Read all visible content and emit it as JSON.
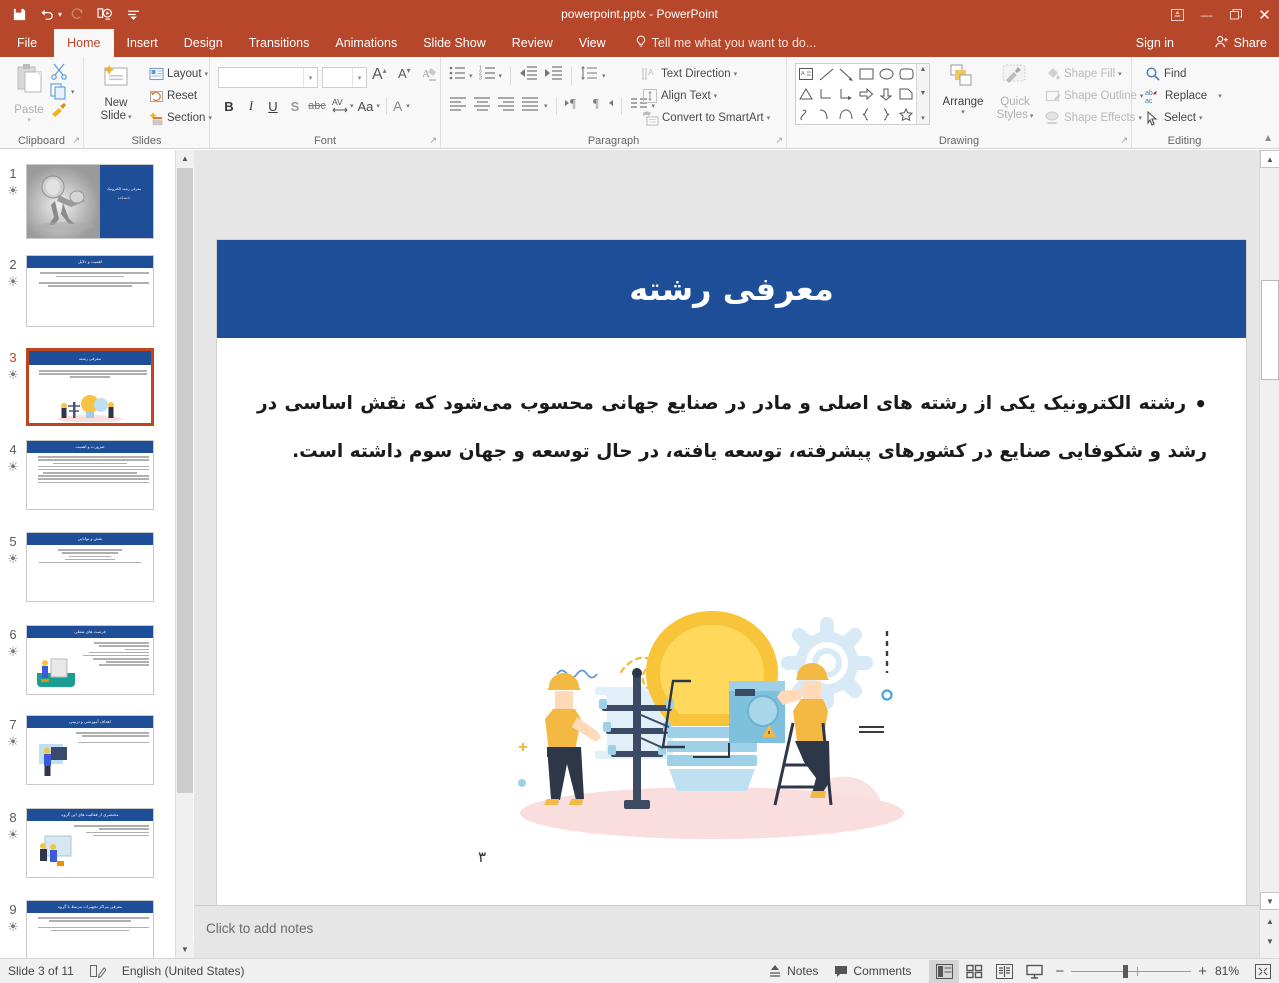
{
  "titlebar": {
    "document_title": "powerpoint.pptx - PowerPoint",
    "qat": [
      {
        "name": "save-icon",
        "label": "Save"
      },
      {
        "name": "undo-icon",
        "label": "Undo"
      },
      {
        "name": "redo-icon",
        "label": "Redo"
      },
      {
        "name": "start-presentation-icon",
        "label": "Start From Beginning"
      },
      {
        "name": "customize-qat-icon",
        "label": "Customize Quick Access Toolbar"
      }
    ],
    "window_controls": {
      "ribbon_display": "⬜",
      "minimize": "—",
      "restore": "❐",
      "close": "✕"
    }
  },
  "tabs": [
    {
      "label": "File",
      "active": false
    },
    {
      "label": "Home",
      "active": true
    },
    {
      "label": "Insert",
      "active": false
    },
    {
      "label": "Design",
      "active": false
    },
    {
      "label": "Transitions",
      "active": false
    },
    {
      "label": "Animations",
      "active": false
    },
    {
      "label": "Slide Show",
      "active": false
    },
    {
      "label": "Review",
      "active": false
    },
    {
      "label": "View",
      "active": false
    }
  ],
  "tellme": {
    "placeholder": "Tell me what you want to do..."
  },
  "account": {
    "signin": "Sign in",
    "share": "Share"
  },
  "ribbon": {
    "groups": [
      {
        "name": "clipboard",
        "label": "Clipboard"
      },
      {
        "name": "slides",
        "label": "Slides"
      },
      {
        "name": "font",
        "label": "Font"
      },
      {
        "name": "paragraph",
        "label": "Paragraph"
      },
      {
        "name": "drawing",
        "label": "Drawing"
      },
      {
        "name": "editing",
        "label": "Editing"
      }
    ],
    "clipboard": {
      "paste": "Paste",
      "cut": "Cut",
      "copy": "Copy",
      "format_painter": "Format Painter"
    },
    "slides": {
      "new_slide": "New\nSlide",
      "new_slide_line1": "New",
      "new_slide_line2": "Slide",
      "layout": "Layout",
      "reset": "Reset",
      "section": "Section"
    },
    "font": {
      "font_name": "",
      "font_size": "",
      "grow_font": "A",
      "shrink_font": "A",
      "clear_formatting": "Clear All Formatting",
      "bold": "B",
      "italic": "I",
      "underline": "U",
      "shadow": "S",
      "strikethrough": "abc",
      "character_spacing": "AV",
      "change_case": "Aa",
      "font_color": "A"
    },
    "paragraph": {
      "text_direction": "Text Direction",
      "align_text": "Align Text",
      "convert_to_smartart": "Convert to SmartArt"
    },
    "drawing": {
      "arrange": "Arrange",
      "quick_styles_line1": "Quick",
      "quick_styles_line2": "Styles",
      "shape_fill": "Shape Fill",
      "shape_outline": "Shape Outline",
      "shape_effects": "Shape Effects"
    },
    "editing": {
      "find": "Find",
      "replace": "Replace",
      "select": "Select"
    }
  },
  "slide_panel": {
    "slides": [
      {
        "number": "1",
        "title": "",
        "type": "picture-title",
        "selected": false
      },
      {
        "number": "2",
        "title": "اهمیت و دلایل",
        "type": "bullets",
        "selected": false
      },
      {
        "number": "3",
        "title": "معرفی رشته",
        "type": "bullets-image",
        "selected": true
      },
      {
        "number": "4",
        "title": "ضرورت و اهمیت",
        "type": "bullets",
        "selected": false
      },
      {
        "number": "5",
        "title": "نقش و توانایی",
        "type": "bullets",
        "selected": false
      },
      {
        "number": "6",
        "title": "فرصت های شغلی",
        "type": "bullets-image",
        "selected": false
      },
      {
        "number": "7",
        "title": "اهداف آموزشی و تربیتی",
        "type": "bullets-image",
        "selected": false
      },
      {
        "number": "8",
        "title": "مختصری از فعالیت های این گروه",
        "type": "bullets-image",
        "selected": false
      },
      {
        "number": "9",
        "title": "معرفی مراکز تجهیزات مرتبط با گروه",
        "type": "bullets",
        "selected": false
      }
    ],
    "star_glyph": "☀"
  },
  "slide": {
    "title": "معرفی رشته",
    "bullet_marker": "•",
    "body": "رشته الکترونیک یکی از رشته های اصلی و مادر در صنایع جهانی محسوب می‌شود که نقش اساسی در رشد و شکوفایی صنایع در کشورهای پیشرفته، توسعه یافته، در حال توسعه و جهان سوم داشته است.",
    "page_number": "۳",
    "title_bg": "#1F4E98",
    "illustration_name": "electrical-engineering-illustration"
  },
  "notes": {
    "placeholder": "Click to add notes"
  },
  "statusbar": {
    "slide_indicator": "Slide 3 of 11",
    "language": "English (United States)",
    "spellcheck_icon": "proofing-icon",
    "notes_label": "Notes",
    "comments_label": "Comments",
    "views": [
      {
        "name": "normal-view",
        "active": true
      },
      {
        "name": "slide-sorter-view",
        "active": false
      },
      {
        "name": "reading-view",
        "active": false
      },
      {
        "name": "slide-show-view",
        "active": false
      }
    ],
    "zoom_out": "−",
    "zoom_in": "+",
    "zoom_level": "81%",
    "fit_slide": "fit-to-window-icon"
  },
  "colors": {
    "accent": "#B7472A",
    "slide_title_blue": "#1F4E98",
    "ribbon_bg": "#F8F8F8",
    "canvas_bg": "#E6E6E6"
  }
}
